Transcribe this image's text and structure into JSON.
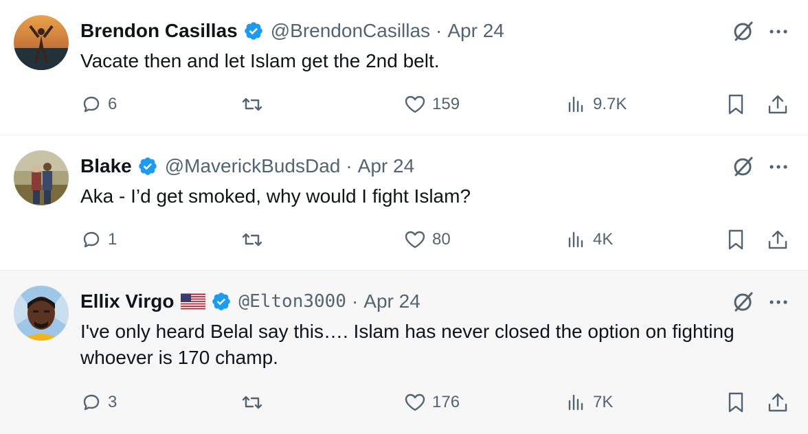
{
  "tweets": [
    {
      "name": "Brendon Casillas",
      "handle": "@BrendonCasillas",
      "separator": "·",
      "date": "Apr 24",
      "text": "Vacate then and let Islam get the 2nd belt.",
      "replies": "6",
      "likes": "159",
      "views": "9.7K"
    },
    {
      "name": "Blake",
      "handle": "@MaverickBudsDad",
      "separator": "·",
      "date": "Apr 24",
      "text": "Aka - I’d get smoked, why would I fight Islam?",
      "replies": "1",
      "likes": "80",
      "views": "4K"
    },
    {
      "name": "Ellix Virgo",
      "handle": "@Elton3000",
      "separator": "·",
      "date": "Apr 24",
      "text": "I've only heard Belal say this…. Islam has never closed the option on fighting whoever is 170 champ.",
      "replies": "3",
      "likes": "176",
      "views": "7K"
    }
  ],
  "colors": {
    "verified": "#1d9bf0",
    "secondary_text": "#536471",
    "primary_text": "#0f1419"
  },
  "icons": [
    "verified-badge-icon",
    "grok-icon",
    "more-icon",
    "reply-icon",
    "retweet-icon",
    "like-icon",
    "views-icon",
    "bookmark-icon",
    "share-icon",
    "us-flag-icon"
  ]
}
